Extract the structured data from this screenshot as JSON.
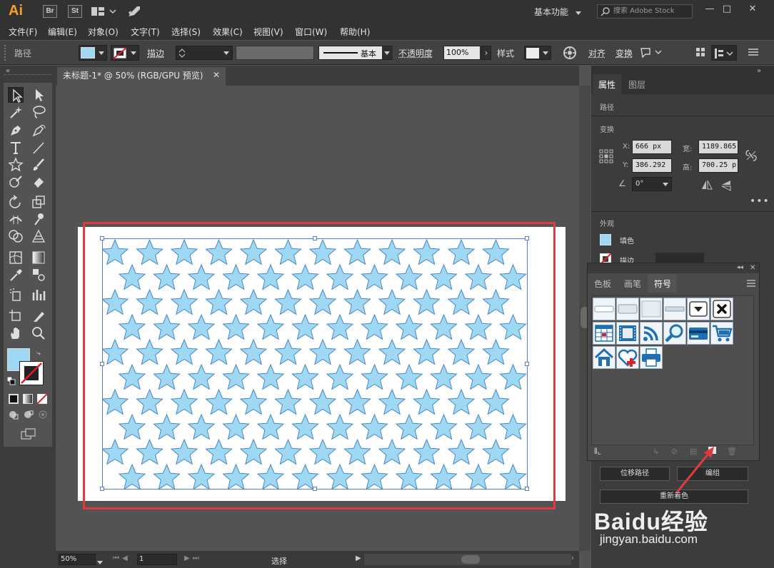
{
  "app": {
    "logo": "Ai",
    "bridge": "Br",
    "stock": "St",
    "workspace": "基本功能",
    "stock_search_placeholder": "搜索 Adobe Stock",
    "window_controls": [
      "—",
      "□",
      "✕"
    ]
  },
  "menu": [
    "文件(F)",
    "编辑(E)",
    "对象(O)",
    "文字(T)",
    "选择(S)",
    "效果(C)",
    "视图(V)",
    "窗口(W)",
    "帮助(H)"
  ],
  "control_bar": {
    "object_type": "路径",
    "stroke_label": "描边",
    "stroke_profile": "基本",
    "opacity_label": "不透明度",
    "opacity_value": "100%",
    "style_label": "样式",
    "align_label": "对齐",
    "transform_label": "变换",
    "fill_color": "#9fd8f2"
  },
  "document": {
    "tab_title": "未标题-1* @ 50% (RGB/GPU 预览)",
    "zoom": "50%",
    "page": "1",
    "status": "选择",
    "star_fill": "#9fd8f2",
    "star_stroke": "#4a88c7",
    "highlight_color": "#e0393e"
  },
  "properties": {
    "tabs": [
      "属性",
      "图层"
    ],
    "object_type": "路径",
    "transform_label": "变换",
    "x_label": "X:",
    "x_value": "666 px",
    "y_label": "Y:",
    "y_value": "386.292",
    "width_label": "宽:",
    "width_value": "1189.865",
    "height_label": "高:",
    "height_value": "700.25 p",
    "rotate_value": "0°",
    "appearance_label": "外观",
    "fill_label": "填色",
    "stroke_label": "描边",
    "offset_path_button": "位移路径",
    "group_button": "编组",
    "recolor_button": "重新着色"
  },
  "symbols_panel": {
    "tabs": [
      "色板",
      "画笔",
      "符号"
    ],
    "active_tab": "符号",
    "symbols": [
      "button-1",
      "button-2",
      "button-3",
      "button-4",
      "dropdown-arrow",
      "close-x",
      "table",
      "film",
      "rss-feed",
      "magnifier",
      "credit-card",
      "shopping-cart",
      "home",
      "heart-plus",
      "printer"
    ]
  },
  "watermark": {
    "brand": "Baidu经验",
    "url": "jingyan.baidu.com"
  }
}
